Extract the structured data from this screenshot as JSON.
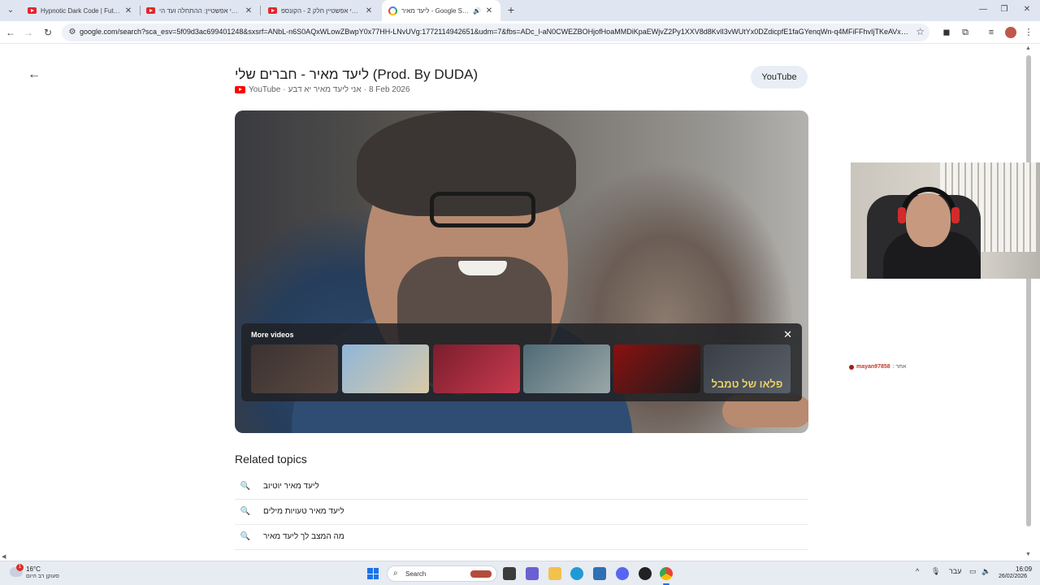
{
  "browser": {
    "tabs": [
      {
        "title": "Hypnotic Dark Code | Futuristic",
        "favicon": "youtube-icon"
      },
      {
        "title": "גפרי אפשטיין: ההתחלה ועד הי",
        "favicon": "youtube-icon"
      },
      {
        "title": "גפרי אפשטיין חלק 2 - הקונספ",
        "favicon": "youtube-icon"
      },
      {
        "title": "ליעד מאיר - Google Search",
        "favicon": "google-icon",
        "active": true,
        "audio": true
      }
    ],
    "new_tab_label": "+",
    "url": "google.com/search?sca_esv=5f09d3ac699401248&sxsrf=ANbL-n6S0AQxWLowZBwpY0x77HH-LNvUVg:1772114942651&udm=7&fbs=ADc_l-aN0CWEZBOHjofHoaMMDiKpaEWjvZ2Py1XXV8d8KvlI3vWUtYx0DZdicpfE1faGYenqWn-q4MFiFFhvIjTKeAVxqtD2OJgNgqfuyx..."
  },
  "result": {
    "title": "ליעד מאיר - חברים שלי (Prod. By DUDA)",
    "source": "YouTube",
    "channel": "אני ליעד מאיר יא דבע",
    "date": "8 Feb 2026",
    "separator": "·",
    "open_button": "YouTube"
  },
  "player": {
    "more_videos_title": "More videos",
    "thumbnails": [
      {
        "colors": [
          "#3b3230",
          "#5c4a43"
        ],
        "caption": ""
      },
      {
        "colors": [
          "#8fb6d8",
          "#d9c9a8"
        ],
        "caption": ""
      },
      {
        "colors": [
          "#7a1d2d",
          "#c83a4e"
        ],
        "caption": ""
      },
      {
        "colors": [
          "#4f6a75",
          "#9aa7a8"
        ],
        "caption": ""
      },
      {
        "colors": [
          "#8a1010",
          "#1c1c1c"
        ],
        "caption": ""
      },
      {
        "colors": [
          "#3a3f47",
          "#5a6068"
        ],
        "caption": "פלאו של טמבל"
      }
    ]
  },
  "related": {
    "title": "Related topics",
    "items": [
      {
        "text": "ליעד מאיר יוטיוב"
      },
      {
        "text": "ליעד מאיר טעויות מילים"
      },
      {
        "text": "מה המצב לך ליעד מאיר"
      }
    ]
  },
  "overlay": {
    "chat_user": "mayan97858",
    "chat_suffix": ": אחר"
  },
  "taskbar": {
    "weather_temp": "16°C",
    "weather_desc": "סעוקן רב היום",
    "weather_badge": "1",
    "search_label": "Search",
    "language": "עבר",
    "time": "16:09",
    "date": "26/02/2026"
  },
  "colors": {
    "youtube_red": "#ff0000",
    "chip_bg": "#e9eef6",
    "accent": "#1a73e8"
  }
}
